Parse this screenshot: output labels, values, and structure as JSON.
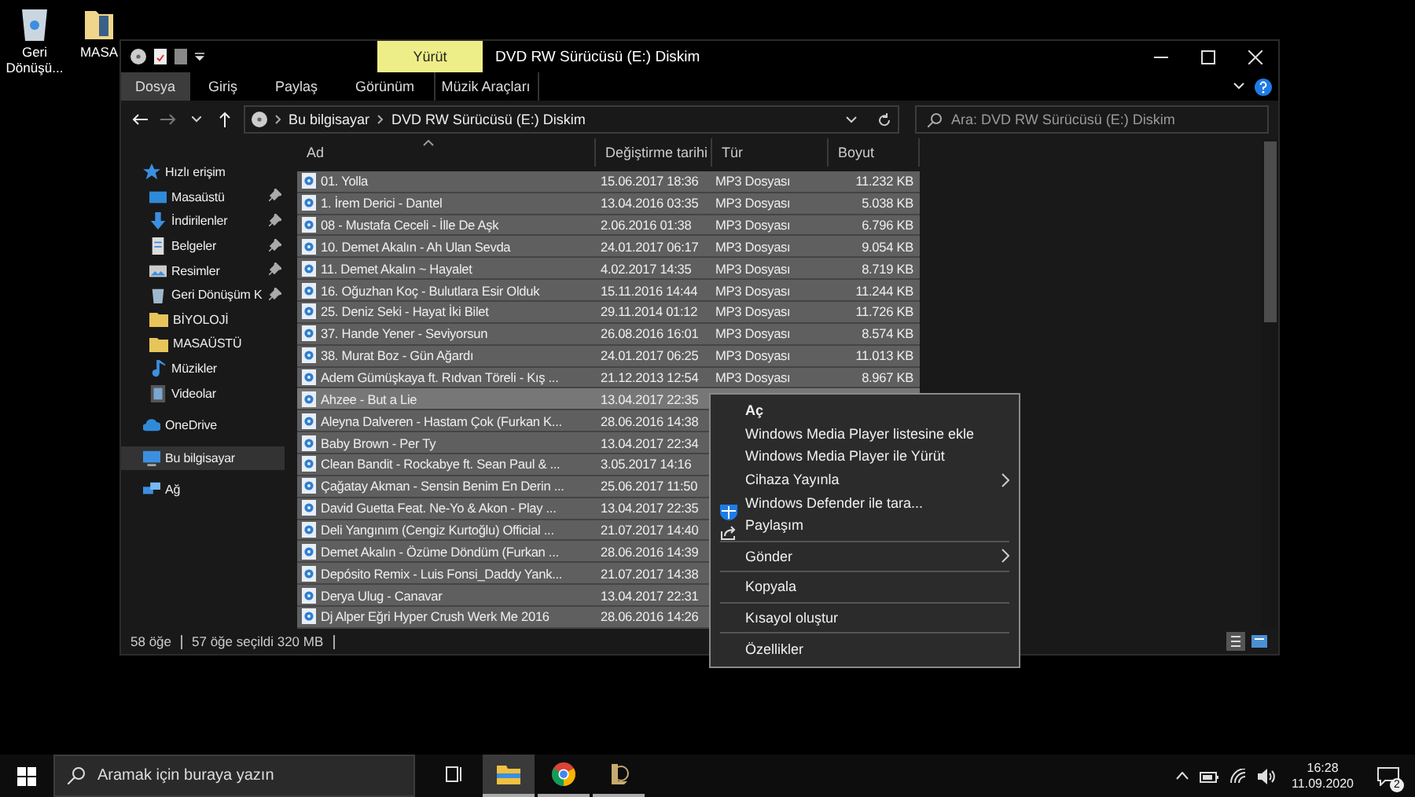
{
  "desktop": {
    "icons": [
      {
        "label": "Geri Dönüşü...",
        "kind": "recycle"
      },
      {
        "label": "MASA",
        "kind": "folder"
      }
    ]
  },
  "window": {
    "title": "DVD RW Sürücüsü (E:) Diskim",
    "contextual_tab": "Yürüt",
    "ribbon_tabs": [
      {
        "label": "Dosya",
        "kind": "file"
      },
      {
        "label": "Giriş",
        "kind": "tab"
      },
      {
        "label": "Paylaş",
        "kind": "tab"
      },
      {
        "label": "Görünüm",
        "kind": "tab"
      },
      {
        "label": "Müzik Araçları",
        "kind": "contextual"
      }
    ],
    "address": {
      "path": [
        "Bu bilgisayar",
        "DVD RW Sürücüsü (E:) Diskim"
      ]
    },
    "search": {
      "placeholder": "Ara: DVD RW Sürücüsü (E:) Diskim"
    },
    "sidebar": {
      "items": [
        {
          "label": "Hızlı erişim",
          "kind": "star",
          "selected": false,
          "children": [
            {
              "label": "Masaüstü",
              "kind": "desktop",
              "pinned": true,
              "selected": false
            },
            {
              "label": "İndirilenler",
              "kind": "download",
              "pinned": true,
              "selected": false
            },
            {
              "label": "Belgeler",
              "kind": "documents",
              "pinned": true,
              "selected": false
            },
            {
              "label": "Resimler",
              "kind": "pictures",
              "pinned": true,
              "selected": false
            },
            {
              "label": "Geri Dönüşüm K",
              "kind": "recycle",
              "pinned": true,
              "selected": false
            },
            {
              "label": "BİYOLOJİ",
              "kind": "folder",
              "pinned": false,
              "selected": false
            },
            {
              "label": "MASAÜSTÜ",
              "kind": "folder",
              "pinned": false,
              "selected": false
            },
            {
              "label": "Müzikler",
              "kind": "music",
              "pinned": false,
              "selected": false
            },
            {
              "label": "Videolar",
              "kind": "video",
              "pinned": false,
              "selected": false
            }
          ]
        },
        {
          "label": "OneDrive",
          "kind": "cloud",
          "selected": false
        },
        {
          "label": "Bu bilgisayar",
          "kind": "computer",
          "selected": true
        },
        {
          "label": "Ağ",
          "kind": "network",
          "selected": false
        }
      ]
    },
    "files": {
      "columns": [
        "Ad",
        "Değiştirme tarihi",
        "Tür",
        "Boyut"
      ],
      "rows": [
        {
          "name": "01. Yolla",
          "date": "15.06.2017 18:36",
          "type": "MP3 Dosyası",
          "size": "11.232 KB",
          "selected": true,
          "focused": false
        },
        {
          "name": "1. İrem Derici - Dantel",
          "date": "13.04.2016 03:35",
          "type": "MP3 Dosyası",
          "size": "5.038 KB",
          "selected": true,
          "focused": false
        },
        {
          "name": "08 - Mustafa Ceceli - İlle De Aşk",
          "date": "2.06.2016 01:38",
          "type": "MP3 Dosyası",
          "size": "6.796 KB",
          "selected": true,
          "focused": false
        },
        {
          "name": "10. Demet Akalın - Ah Ulan Sevda",
          "date": "24.01.2017 06:17",
          "type": "MP3 Dosyası",
          "size": "9.054 KB",
          "selected": true,
          "focused": false
        },
        {
          "name": "11. Demet Akalın ~ Hayalet",
          "date": "4.02.2017 14:35",
          "type": "MP3 Dosyası",
          "size": "8.719 KB",
          "selected": true,
          "focused": false
        },
        {
          "name": "16. Oğuzhan Koç - Bulutlara Esir Olduk",
          "date": "15.11.2016 14:44",
          "type": "MP3 Dosyası",
          "size": "11.244 KB",
          "selected": true,
          "focused": false
        },
        {
          "name": "25. Deniz Seki - Hayat İki Bilet",
          "date": "29.11.2014 01:12",
          "type": "MP3 Dosyası",
          "size": "11.726 KB",
          "selected": true,
          "focused": false
        },
        {
          "name": "37. Hande Yener - Seviyorsun",
          "date": "26.08.2016 16:01",
          "type": "MP3 Dosyası",
          "size": "8.574 KB",
          "selected": true,
          "focused": false
        },
        {
          "name": "38. Murat Boz - Gün Ağardı",
          "date": "24.01.2017 06:25",
          "type": "MP3 Dosyası",
          "size": "11.013 KB",
          "selected": true,
          "focused": false
        },
        {
          "name": "Adem Gümüşkaya ft. Rıdvan Töreli - Kış ...",
          "date": "21.12.2013 12:54",
          "type": "MP3 Dosyası",
          "size": "8.967 KB",
          "selected": true,
          "focused": false
        },
        {
          "name": "Ahzee - But a Lie",
          "date": "13.04.2017 22:35",
          "selected": true,
          "focused": true
        },
        {
          "name": "Aleyna Dalveren - Hastam Çok (Furkan K...",
          "date": "28.06.2016 14:38",
          "selected": true,
          "focused": false
        },
        {
          "name": "Baby Brown - Per Ty",
          "date": "13.04.2017 22:34",
          "selected": true,
          "focused": false
        },
        {
          "name": "Clean Bandit - Rockabye ft. Sean Paul & ...",
          "date": "3.05.2017 14:16",
          "selected": true,
          "focused": false
        },
        {
          "name": "Çağatay Akman - Sensin Benim En Derin ...",
          "date": "25.06.2017 11:50",
          "selected": true,
          "focused": false
        },
        {
          "name": "David Guetta Feat. Ne-Yo & Akon - Play ...",
          "date": "13.04.2017 22:35",
          "selected": true,
          "focused": false
        },
        {
          "name": "Deli Yangınım (Cengiz Kurtoğlu) Official ...",
          "date": "21.07.2017 14:40",
          "selected": true,
          "focused": false
        },
        {
          "name": "Demet Akalın - Özüme Döndüm (Furkan ...",
          "date": "28.06.2016 14:39",
          "selected": true,
          "focused": false
        },
        {
          "name": "Depósito Remix - Luis Fonsi_Daddy Yank...",
          "date": "21.07.2017 14:38",
          "selected": true,
          "focused": false
        },
        {
          "name": "Derya Ulug - Canavar",
          "date": "13.04.2017 22:31",
          "selected": true,
          "focused": false
        },
        {
          "name": "Dj Alper Eğri  Hyper Crush  Werk Me 2016",
          "date": "28.06.2016 14:26",
          "selected": true,
          "focused": false
        }
      ]
    },
    "status_bar": {
      "count": "58 öğe",
      "selection": "57 öğe seçildi  320 MB"
    }
  },
  "context_menu": {
    "groups": [
      [
        {
          "label": "Aç",
          "default": true,
          "submenu": false
        },
        {
          "label": "Windows Media Player listesine ekle",
          "default": false,
          "submenu": false
        },
        {
          "label": "Windows Media Player ile Yürüt",
          "default": false,
          "submenu": false
        },
        {
          "label": "Cihaza Yayınla",
          "default": false,
          "submenu": true
        },
        {
          "label": "Windows Defender ile tara...",
          "default": false,
          "submenu": false,
          "kind": "shield"
        },
        {
          "label": "Paylaşım",
          "default": false,
          "submenu": false,
          "kind": "share"
        }
      ],
      [
        {
          "label": "Gönder",
          "default": false,
          "submenu": true
        }
      ],
      [
        {
          "label": "Kopyala",
          "default": false,
          "submenu": false
        }
      ],
      [
        {
          "label": "Kısayol oluştur",
          "default": false,
          "submenu": false
        }
      ],
      [
        {
          "label": "Özellikler",
          "default": false,
          "submenu": false
        }
      ]
    ]
  },
  "taskbar": {
    "search_placeholder": "Aramak için buraya yazın",
    "apps": [
      {
        "kind": "taskview",
        "running": false,
        "active": false
      },
      {
        "kind": "explorer",
        "running": true,
        "active": true
      },
      {
        "kind": "chrome",
        "running": true,
        "active": false
      },
      {
        "kind": "league",
        "running": true,
        "active": false
      }
    ],
    "time": "16:28",
    "date": "11.09.2020",
    "notifications": "2"
  }
}
